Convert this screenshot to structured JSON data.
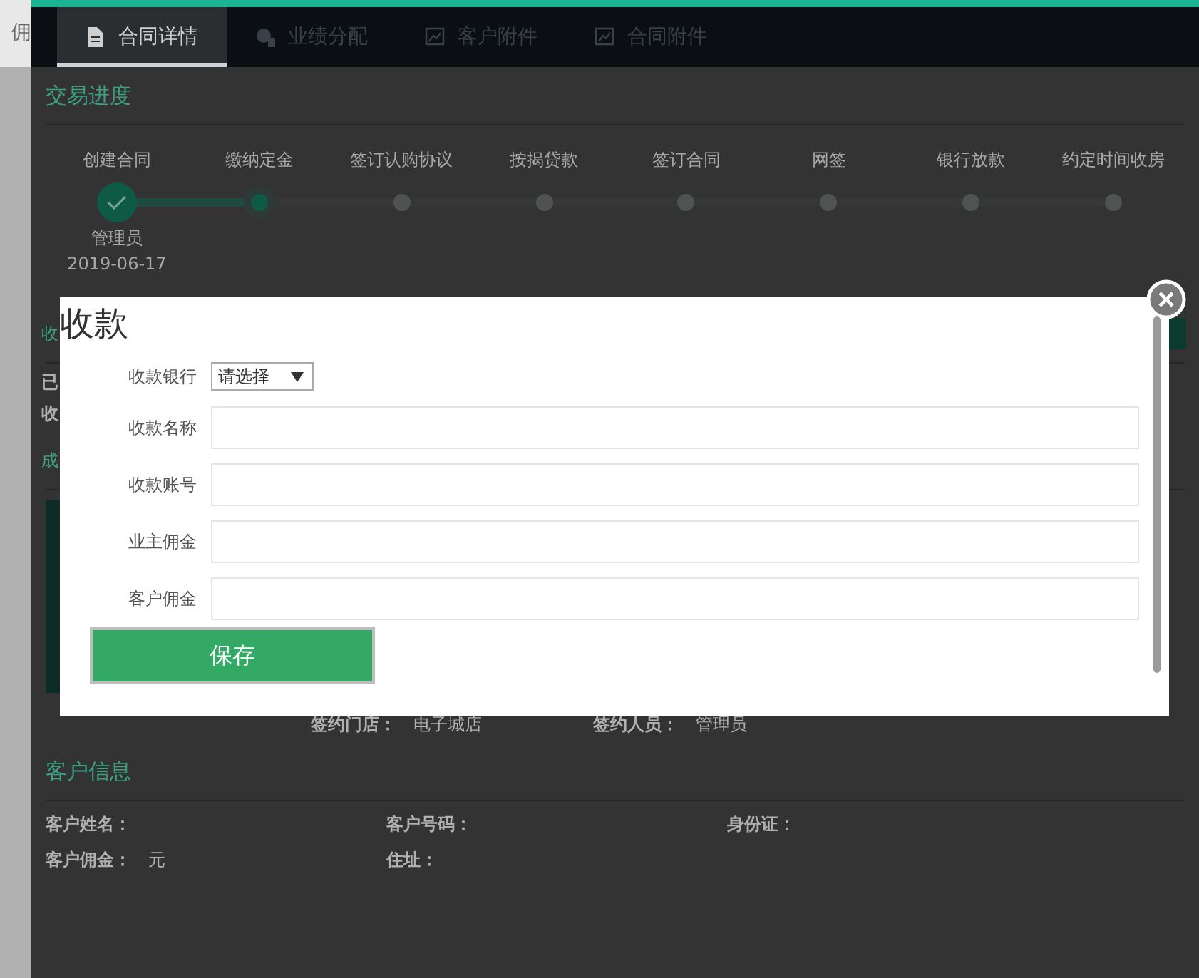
{
  "side_tab": {
    "label": "佣"
  },
  "tabs": [
    {
      "label": "合同详情",
      "selected": true
    },
    {
      "label": "业绩分配",
      "selected": false
    },
    {
      "label": "客户附件",
      "selected": false
    },
    {
      "label": "合同附件",
      "selected": false
    }
  ],
  "progress": {
    "title": "交易进度",
    "steps": [
      {
        "label": "创建合同",
        "kind": "done",
        "operator": "管理员",
        "date": "2019-06-17"
      },
      {
        "label": "缴纳定金",
        "kind": "current"
      },
      {
        "label": "签订认购协议",
        "kind": "pending"
      },
      {
        "label": "按揭贷款",
        "kind": "pending"
      },
      {
        "label": "签订合同",
        "kind": "pending"
      },
      {
        "label": "网签",
        "kind": "pending"
      },
      {
        "label": "银行放款",
        "kind": "pending"
      },
      {
        "label": "约定时间收房",
        "kind": "pending"
      }
    ]
  },
  "section_2": {
    "title": "收",
    "lines": [
      "已",
      "收"
    ]
  },
  "section_3": {
    "title": "成"
  },
  "signing": {
    "fields": [
      {
        "label": "签约门店：",
        "value": "电子城店"
      },
      {
        "label": "签约人员：",
        "value": "管理员"
      }
    ]
  },
  "customer_info": {
    "title": "客户信息",
    "fields": [
      {
        "label": "客户姓名："
      },
      {
        "label": "客户号码："
      },
      {
        "label": "身份证："
      },
      {
        "label": "客户佣金：",
        "value": "元"
      },
      {
        "label": "住址："
      }
    ]
  },
  "modal": {
    "title": "收款",
    "fields": [
      {
        "label": "收款银行",
        "kind": "select",
        "value": "请选择"
      },
      {
        "label": "收款名称",
        "kind": "text"
      },
      {
        "label": "收款账号",
        "kind": "text"
      },
      {
        "label": "业主佣金",
        "kind": "text"
      },
      {
        "label": "客户佣金",
        "kind": "text"
      }
    ],
    "buttons": [
      "保存"
    ]
  }
}
